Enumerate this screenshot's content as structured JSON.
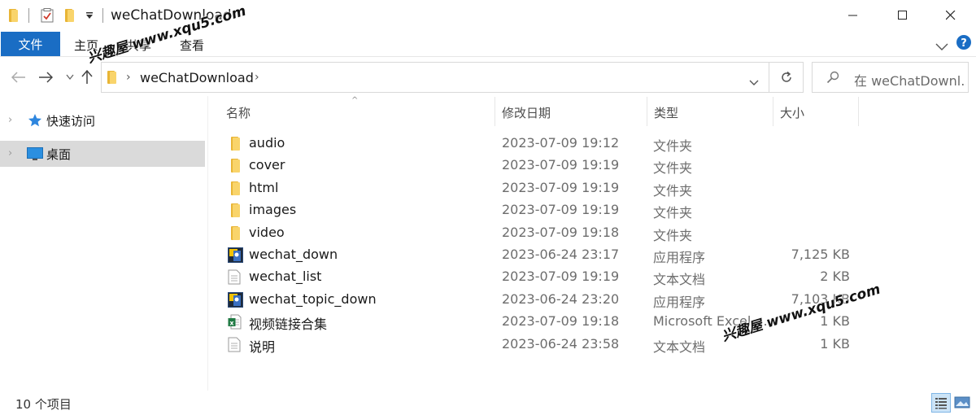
{
  "window": {
    "title": "weChatDownload"
  },
  "ribbon": {
    "file_tab": "文件",
    "tabs": [
      "主页",
      "共享",
      "查看"
    ]
  },
  "address": {
    "path": "weChatDownload",
    "search_placeholder": "在 weChatDownl..."
  },
  "nav": {
    "items": [
      {
        "label": "快速访问",
        "icon": "star-icon"
      },
      {
        "label": "桌面",
        "icon": "desktop-icon"
      }
    ]
  },
  "columns": {
    "name": "名称",
    "date": "修改日期",
    "type": "类型",
    "size": "大小"
  },
  "files": [
    {
      "name": "audio",
      "date": "2023-07-09 19:12",
      "type": "文件夹",
      "size": "",
      "icon": "folder-icon"
    },
    {
      "name": "cover",
      "date": "2023-07-09 19:19",
      "type": "文件夹",
      "size": "",
      "icon": "folder-icon"
    },
    {
      "name": "html",
      "date": "2023-07-09 19:19",
      "type": "文件夹",
      "size": "",
      "icon": "folder-icon"
    },
    {
      "name": "images",
      "date": "2023-07-09 19:19",
      "type": "文件夹",
      "size": "",
      "icon": "folder-icon"
    },
    {
      "name": "video",
      "date": "2023-07-09 19:18",
      "type": "文件夹",
      "size": "",
      "icon": "folder-icon"
    },
    {
      "name": "wechat_down",
      "date": "2023-06-24 23:17",
      "type": "应用程序",
      "size": "7,125 KB",
      "icon": "app-icon"
    },
    {
      "name": "wechat_list",
      "date": "2023-07-09 19:19",
      "type": "文本文档",
      "size": "2 KB",
      "icon": "text-file-icon"
    },
    {
      "name": "wechat_topic_down",
      "date": "2023-06-24 23:20",
      "type": "应用程序",
      "size": "7,103 KB",
      "icon": "app-icon"
    },
    {
      "name": "视频链接合集",
      "date": "2023-07-09 19:18",
      "type": "Microsoft Excel ...",
      "size": "1 KB",
      "icon": "excel-icon"
    },
    {
      "name": "说明",
      "date": "2023-06-24 23:58",
      "type": "文本文档",
      "size": "1 KB",
      "icon": "text-file-icon"
    }
  ],
  "status": {
    "item_count": "10 个项目"
  },
  "watermark": {
    "text": "兴趣屋 www.xqu5.com"
  },
  "colors": {
    "accent": "#1a6dc4",
    "folder": "#f9d46b",
    "selected": "#dadada"
  }
}
